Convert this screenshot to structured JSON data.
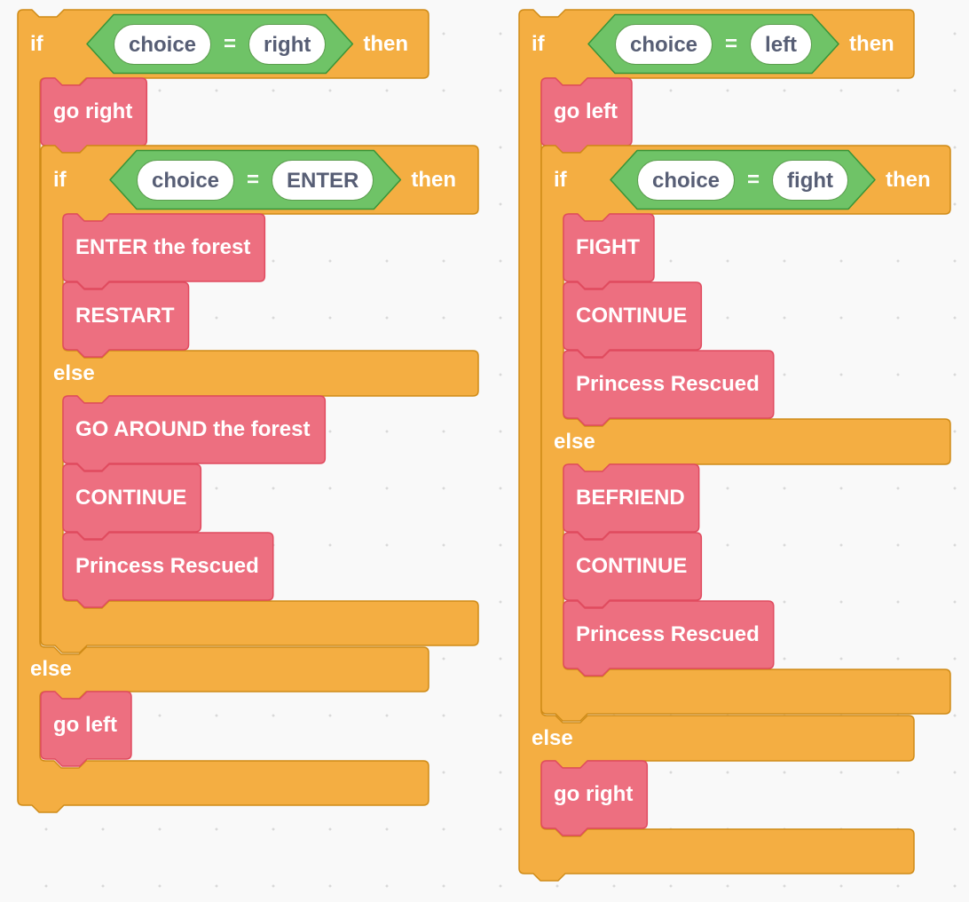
{
  "theme": {
    "control": "#f4ae42",
    "control_border": "#cf8b17",
    "operator": "#6fc367",
    "operator_border": "#389438",
    "custom": "#ed6f80",
    "custom_border": "#e04b5f",
    "pill_text": "#575e75"
  },
  "scripts": [
    {
      "id": "left",
      "if_label": "if",
      "then_label": "then",
      "else_label": "else",
      "condition": {
        "variable": "choice",
        "operator": "=",
        "value": "right"
      },
      "then_branch": {
        "call": "go right",
        "nested": {
          "if_label": "if",
          "then_label": "then",
          "else_label": "else",
          "condition": {
            "variable": "choice",
            "operator": "=",
            "value": "ENTER"
          },
          "then_calls": [
            "ENTER the forest",
            "RESTART"
          ],
          "else_calls": [
            "GO AROUND the forest",
            "CONTINUE",
            "Princess Rescued"
          ]
        }
      },
      "else_calls": [
        "go left"
      ]
    },
    {
      "id": "right",
      "if_label": "if",
      "then_label": "then",
      "else_label": "else",
      "condition": {
        "variable": "choice",
        "operator": "=",
        "value": "left"
      },
      "then_branch": {
        "call": "go left",
        "nested": {
          "if_label": "if",
          "then_label": "then",
          "else_label": "else",
          "condition": {
            "variable": "choice",
            "operator": "=",
            "value": "fight"
          },
          "then_calls": [
            "FIGHT",
            "CONTINUE",
            "Princess Rescued"
          ],
          "else_calls": [
            "BEFRIEND",
            "CONTINUE",
            "Princess Rescued"
          ]
        }
      },
      "else_calls": [
        "go right"
      ]
    }
  ]
}
